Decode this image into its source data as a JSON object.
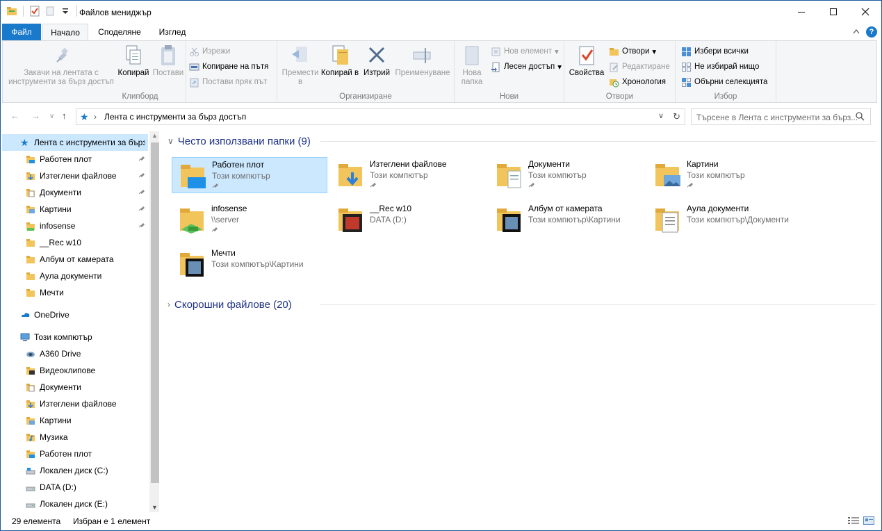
{
  "window": {
    "title": "Файлов мениджър"
  },
  "ribbon_tabs": {
    "file": "Файл",
    "home": "Начало",
    "share": "Споделяне",
    "view": "Изглед"
  },
  "clipboard": {
    "label": "Клипборд",
    "pin": "Закачи на лентата с инструменти за бърз достъп",
    "copy": "Копирай",
    "paste": "Постави",
    "cut": "Изрежи",
    "copy_path": "Копиране на пътя",
    "paste_shortcut": "Постави пряк път"
  },
  "organize": {
    "label": "Организиране",
    "move_to": "Премести в",
    "copy_to": "Копирай в",
    "delete": "Изтрий",
    "rename": "Преименуване"
  },
  "new": {
    "label": "Нови",
    "new_folder": "Нова папка",
    "new_item": "Нов елемент",
    "easy_access": "Лесен достъп"
  },
  "open": {
    "label": "Отвори",
    "properties": "Свойства",
    "open": "Отвори",
    "edit": "Редактиране",
    "history": "Хронология"
  },
  "select": {
    "label": "Избор",
    "select_all": "Избери всички",
    "select_none": "Не избирай нищо",
    "invert": "Обърни селекцията"
  },
  "address": {
    "path": "Лента с инструменти за бърз достъп"
  },
  "search": {
    "placeholder": "Търсене в Лента с инструменти за бърз..."
  },
  "nav_pane": {
    "quick_access": "Лента с инструменти за бърз достъп",
    "items": [
      {
        "label": "Работен плот",
        "pinned": true,
        "icon": "desktop-folder-icon"
      },
      {
        "label": "Изтеглени файлове",
        "pinned": true,
        "icon": "downloads-folder-icon"
      },
      {
        "label": "Документи",
        "pinned": true,
        "icon": "documents-folder-icon"
      },
      {
        "label": "Картини",
        "pinned": true,
        "icon": "pictures-folder-icon"
      },
      {
        "label": "infosense",
        "pinned": true,
        "icon": "network-folder-icon"
      },
      {
        "label": "__Rec w10",
        "pinned": false,
        "icon": "folder-icon"
      },
      {
        "label": "Албум от камерата",
        "pinned": false,
        "icon": "folder-icon"
      },
      {
        "label": "Аула документи",
        "pinned": false,
        "icon": "folder-icon"
      },
      {
        "label": "Мечти",
        "pinned": false,
        "icon": "folder-icon"
      }
    ],
    "onedrive": "OneDrive",
    "this_pc": "Този компютър",
    "pc_items": [
      {
        "label": "A360 Drive",
        "icon": "cloud-drive-icon"
      },
      {
        "label": "Видеоклипове",
        "icon": "videos-folder-icon"
      },
      {
        "label": "Документи",
        "icon": "documents-folder-icon"
      },
      {
        "label": "Изтеглени файлове",
        "icon": "downloads-folder-icon"
      },
      {
        "label": "Картини",
        "icon": "pictures-folder-icon"
      },
      {
        "label": "Музика",
        "icon": "music-folder-icon"
      },
      {
        "label": "Работен плот",
        "icon": "desktop-folder-icon"
      },
      {
        "label": "Локален диск (C:)",
        "icon": "system-drive-icon"
      },
      {
        "label": "DATA (D:)",
        "icon": "drive-icon"
      },
      {
        "label": "Локален диск (E:)",
        "icon": "drive-icon"
      }
    ]
  },
  "content": {
    "frequent_header": "Често използвани папки (9)",
    "recent_header": "Скорошни файлове (20)",
    "tiles": [
      {
        "name": "Работен плот",
        "location": "Този компютър",
        "pinned": true,
        "icon": "desktop-folder-icon"
      },
      {
        "name": "Изтеглени файлове",
        "location": "Този компютър",
        "pinned": true,
        "icon": "downloads-folder-icon"
      },
      {
        "name": "Документи",
        "location": "Този компютър",
        "pinned": true,
        "icon": "documents-folder-icon"
      },
      {
        "name": "Картини",
        "location": "Този компютър",
        "pinned": true,
        "icon": "pictures-folder-icon"
      },
      {
        "name": "infosense",
        "location": "\\\\server",
        "pinned": true,
        "icon": "network-folder-icon"
      },
      {
        "name": "__Rec w10",
        "location": "DATA (D:)",
        "pinned": false,
        "icon": "media-folder-icon"
      },
      {
        "name": "Албум от камерата",
        "location": "Този компютър\\Картини",
        "pinned": false,
        "icon": "photo-folder-icon"
      },
      {
        "name": "Аула документи",
        "location": "Този компютър\\Документи",
        "pinned": false,
        "icon": "docs-folder-icon"
      },
      {
        "name": "Мечти",
        "location": "Този компютър\\Картини",
        "pinned": false,
        "icon": "photo-folder-icon"
      }
    ]
  },
  "status": {
    "count": "29 елемента",
    "selected": "Избран е 1 елемент"
  },
  "colors": {
    "accent": "#1979ca",
    "selection": "#cce8ff",
    "folder": "#f2c55c",
    "header_text": "#1e3287"
  }
}
